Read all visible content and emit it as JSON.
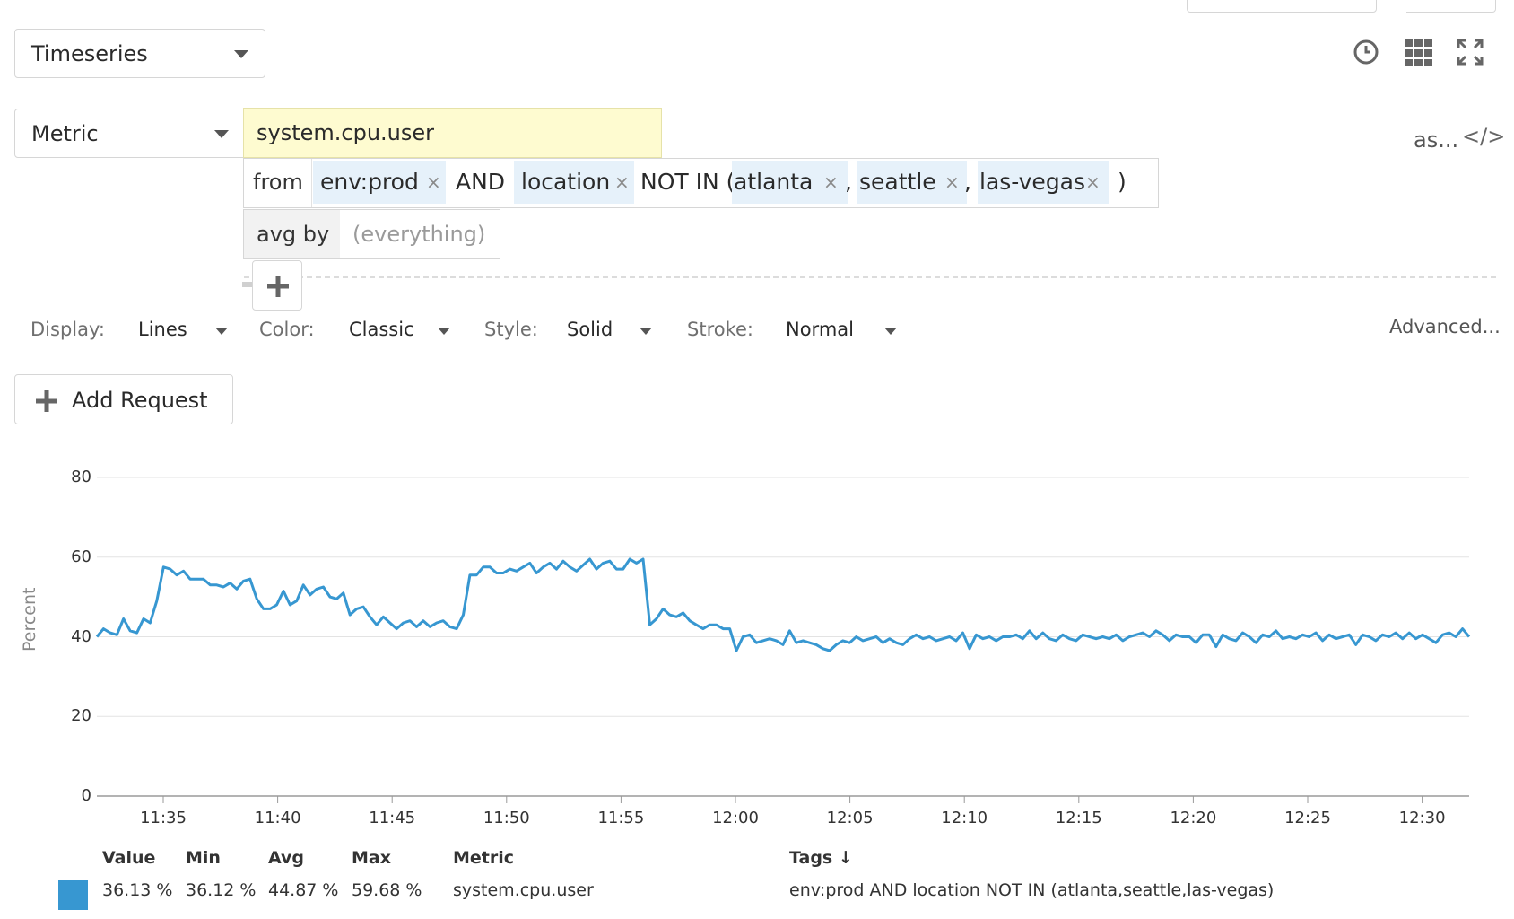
{
  "widget_type": {
    "selected": "Timeseries"
  },
  "toolbar_icons": [
    "clock-icon",
    "grid-icon",
    "fullscreen-icon"
  ],
  "query": {
    "source_type": "Metric",
    "metric_name": "system.cpu.user",
    "from_label": "from",
    "filter": {
      "tag1": "env:prod",
      "and_op": "AND",
      "tag2": "location",
      "not_in_op": "NOT IN (",
      "values": [
        "atlanta",
        "seattle",
        "las-vegas"
      ],
      "comma": ",",
      "close_paren": ")"
    },
    "avg_by_label": "avg by",
    "avg_by_placeholder": "(everything)",
    "alias_label": "as...",
    "code_label": "</>"
  },
  "display_options": {
    "display_label": "Display:",
    "display_value": "Lines",
    "color_label": "Color:",
    "color_value": "Classic",
    "style_label": "Style:",
    "style_value": "Solid",
    "stroke_label": "Stroke:",
    "stroke_value": "Normal",
    "advanced_label": "Advanced..."
  },
  "add_request_label": "Add Request",
  "chart_data": {
    "type": "line",
    "ylabel": "Percent",
    "ylim": [
      0,
      80
    ],
    "yticks": [
      "0",
      "20",
      "40",
      "60",
      "80"
    ],
    "x_ticks": [
      "11:35",
      "11:40",
      "11:45",
      "11:50",
      "11:55",
      "12:00",
      "12:05",
      "12:10",
      "12:15",
      "12:20",
      "12:25",
      "12:30"
    ],
    "grid": true,
    "series": [
      {
        "name": "system.cpu.user",
        "color": "#3797d1",
        "x_start": "11:32:10",
        "x_end": "12:32:10",
        "values": [
          40,
          42,
          41,
          40.5,
          44.5,
          41.5,
          41,
          44.5,
          43.5,
          49,
          57.5,
          57,
          55.5,
          56.5,
          54.5,
          54.5,
          54.5,
          53,
          53,
          52.5,
          53.5,
          52,
          54,
          54.5,
          49.5,
          47,
          47,
          48,
          51.5,
          48,
          49,
          53,
          50.5,
          52,
          52.5,
          50,
          49.5,
          51,
          45.5,
          47,
          47.5,
          45,
          43,
          45,
          43.5,
          42,
          43.5,
          44,
          42.5,
          44,
          42.5,
          43.5,
          44,
          42.5,
          42,
          45.5,
          55.5,
          55.5,
          57.5,
          57.5,
          56,
          56,
          57,
          56.5,
          57.5,
          58.5,
          56,
          57.5,
          58.5,
          57,
          59,
          57.5,
          56.5,
          58,
          59.5,
          57,
          58.5,
          59,
          57,
          57,
          59.5,
          58.5,
          59.5,
          43,
          44.5,
          47,
          45.5,
          45,
          46,
          44,
          43,
          42,
          43,
          43,
          42,
          42,
          36.5,
          40,
          40.5,
          38.5,
          39,
          39.5,
          39,
          38,
          41.5,
          38.5,
          39,
          38.5,
          38,
          37,
          36.5,
          38,
          39,
          38.5,
          40,
          39,
          39.5,
          40,
          38.5,
          39.5,
          38.5,
          38,
          39.5,
          40.5,
          39.5,
          40,
          39,
          39.5,
          40,
          39,
          41,
          37,
          40.5,
          39.5,
          40,
          39,
          40,
          40,
          40.5,
          39.5,
          41.5,
          39.5,
          41,
          39.5,
          39,
          40.5,
          39.5,
          39,
          40.5,
          40,
          39.5,
          40,
          39.5,
          40.5,
          39,
          40,
          40.5,
          41,
          40,
          41.5,
          40.5,
          39,
          40.5,
          40,
          40,
          38.5,
          40.5,
          40.5,
          37.5,
          40.5,
          39.5,
          39,
          41,
          40,
          38.5,
          40.5,
          40,
          41.5,
          39.5,
          40,
          39.5,
          40.5,
          40,
          41,
          39,
          40.5,
          39.5,
          40,
          40.5,
          38,
          40.5,
          40,
          39,
          40.5,
          40,
          41,
          39.5,
          41,
          39.5,
          40.5,
          39.5,
          38.5,
          40.5,
          41,
          40,
          42,
          40
        ]
      }
    ],
    "legend": {
      "headers": [
        "Value",
        "Min",
        "Avg",
        "Max",
        "Metric",
        "Tags ↓"
      ],
      "row": {
        "color": "#3797d1",
        "value": "36.13 %",
        "min": "36.12 %",
        "avg": "44.87 %",
        "max": "59.68 %",
        "metric": "system.cpu.user",
        "tags": "env:prod AND location NOT IN (atlanta,seattle,las-vegas)"
      }
    }
  }
}
